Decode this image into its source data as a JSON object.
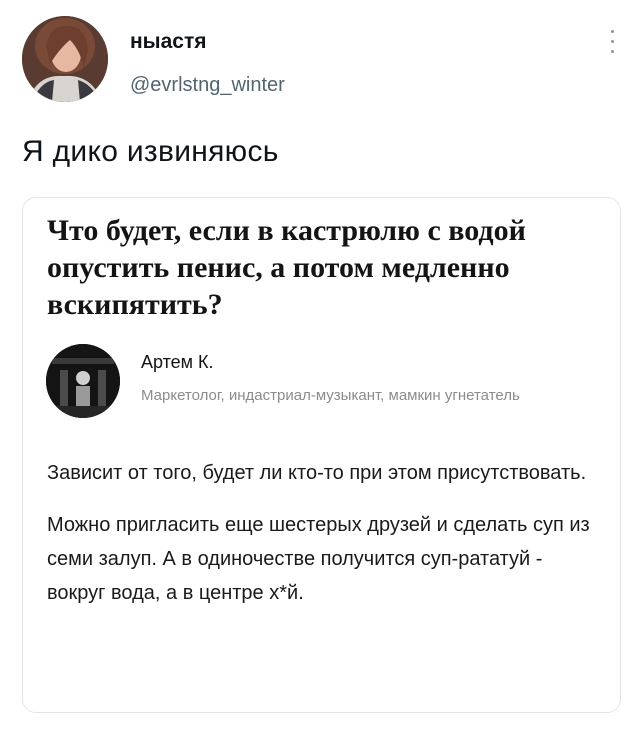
{
  "tweet": {
    "author_name": "ныастя",
    "author_handle": "@evrlstng_winter",
    "text": "Я дико извиняюсь"
  },
  "card": {
    "question": "Что будет, если в кастрюлю с водой опустить пенис, а потом медленно вскипятить?",
    "answer_author": {
      "name": "Артем К.",
      "bio": "Маркетолог, индастриал-музыкант, мамкин угнетатель"
    },
    "answer_paragraphs": [
      "Зависит от того, будет ли кто-то при этом присутствовать.",
      "Можно пригласить еще шестерых друзей и сделать суп из семи залуп. А в одиночестве получится суп-рататуй - вокруг вода, а в центре х*й."
    ]
  },
  "icons": {
    "more": "more-vertical-icon"
  }
}
